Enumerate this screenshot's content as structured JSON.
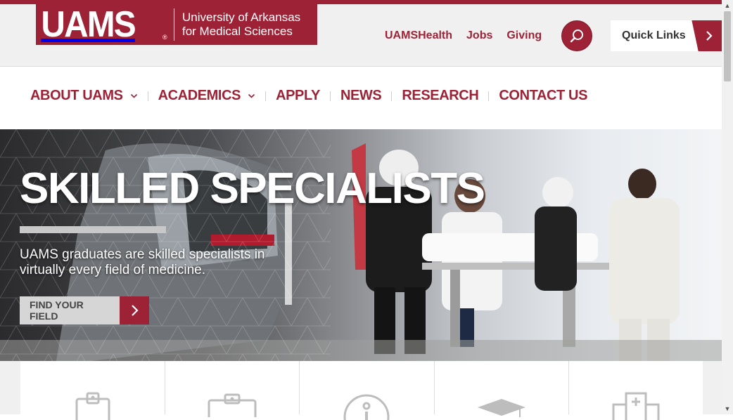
{
  "logo": {
    "mark": "UAMS",
    "registered": "®",
    "line1": "University of Arkansas",
    "line2": "for Medical Sciences"
  },
  "utility_links": [
    "UAMSHealth",
    "Jobs",
    "Giving"
  ],
  "search": {
    "icon": "search-icon"
  },
  "quick_links": {
    "label": "Quick Links",
    "icon": "chevron-right-icon"
  },
  "nav": {
    "items": [
      {
        "label": "ABOUT UAMS",
        "has_dropdown": true
      },
      {
        "label": "ACADEMICS",
        "has_dropdown": true
      },
      {
        "label": "APPLY",
        "has_dropdown": false
      },
      {
        "label": "NEWS",
        "has_dropdown": false
      },
      {
        "label": "RESEARCH",
        "has_dropdown": false
      },
      {
        "label": "CONTACT US",
        "has_dropdown": false
      }
    ]
  },
  "hero": {
    "title": "SKILLED SPECIALISTS",
    "subtitle": "UAMS graduates are skilled specialists in virtually every field of medicine.",
    "cta_label": "FIND YOUR FIELD"
  },
  "cards": [
    {
      "icon": "id-badge-icon"
    },
    {
      "icon": "id-card-icon"
    },
    {
      "icon": "info-circle-icon"
    },
    {
      "icon": "graduation-cap-icon"
    },
    {
      "icon": "hospital-building-icon"
    }
  ],
  "colors": {
    "brand": "#9d2235",
    "utility_bg": "#f1f0f0",
    "cta_gray": "#d6d6d6"
  }
}
